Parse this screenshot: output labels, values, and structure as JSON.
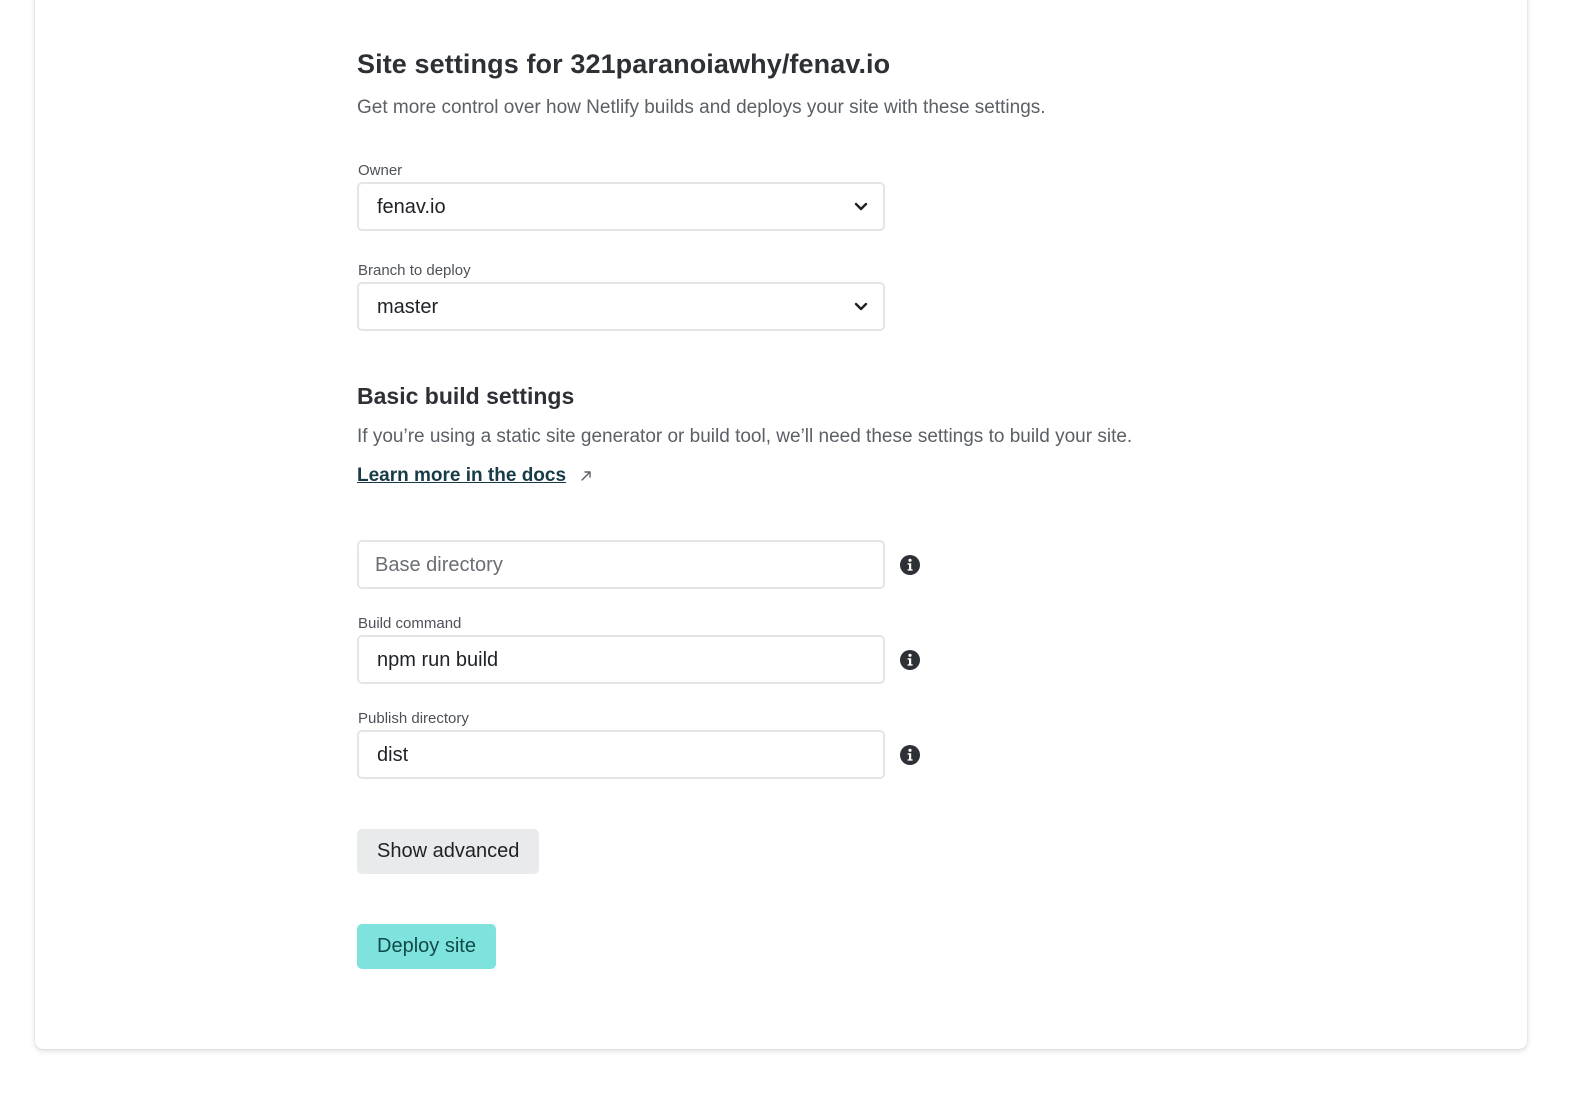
{
  "header": {
    "title": "Site settings for 321paranoiawhy/fenav.io",
    "subtitle": "Get more control over how Netlify builds and deploys your site with these settings."
  },
  "owner": {
    "label": "Owner",
    "selected": "fenav.io"
  },
  "branch": {
    "label": "Branch to deploy",
    "selected": "master"
  },
  "build_settings": {
    "title": "Basic build settings",
    "description": "If you’re using a static site generator or build tool, we’ll need these settings to build your site.",
    "docs_link": "Learn more in the docs",
    "base_directory": {
      "placeholder": "Base directory",
      "value": ""
    },
    "build_command": {
      "label": "Build command",
      "value": "npm run build"
    },
    "publish_directory": {
      "label": "Publish directory",
      "value": "dist"
    }
  },
  "actions": {
    "show_advanced": "Show advanced",
    "deploy": "Deploy site"
  },
  "colors": {
    "deploy_button": "#7fe3dd",
    "link": "#173b47"
  }
}
